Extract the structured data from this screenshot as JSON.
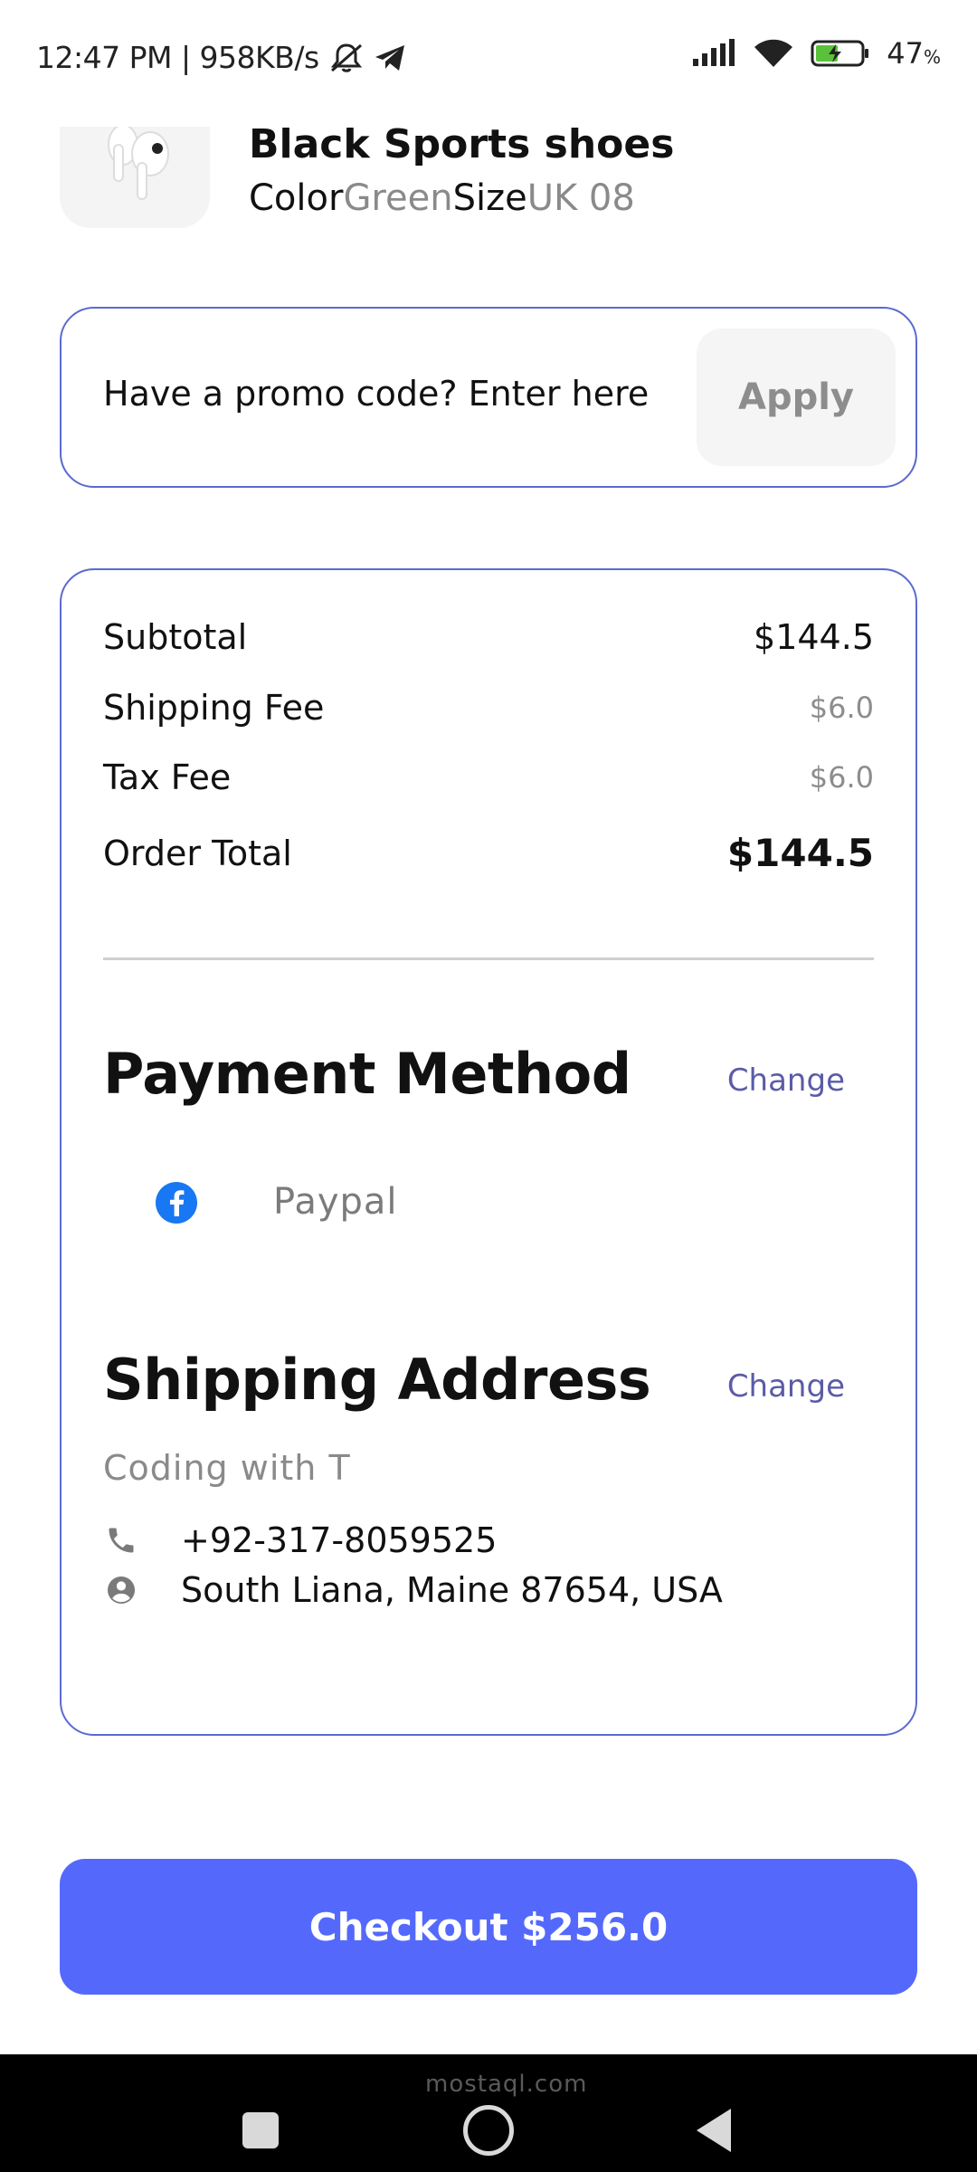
{
  "status_bar": {
    "time_network": "12:47 PM | 958KB/s",
    "battery_percent": "47",
    "battery_unit": "%"
  },
  "product": {
    "name": "Black Sports shoes",
    "color_label": "Color",
    "color_value": "Green",
    "size_label": "Size",
    "size_value": "UK 08"
  },
  "promo": {
    "prompt": "Have a promo code? Enter here",
    "apply_label": "Apply"
  },
  "summary": {
    "rows": [
      {
        "label": "Subtotal",
        "value": "$144.5"
      },
      {
        "label": "Shipping Fee",
        "value": "$6.0"
      },
      {
        "label": "Tax Fee",
        "value": "$6.0"
      },
      {
        "label": "Order Total",
        "value": "$144.5"
      }
    ]
  },
  "payment": {
    "title": "Payment Method",
    "change_label": "Change",
    "method": "Paypal",
    "icon": "facebook-icon"
  },
  "shipping": {
    "title": "Shipping Address",
    "change_label": "Change",
    "name": "Coding with T",
    "phone": "+92-317-8059525",
    "address": "South Liana, Maine 87654, USA"
  },
  "checkout": {
    "label": "Checkout $256.0"
  },
  "nav": {
    "watermark": "mostaql.com"
  },
  "colors": {
    "accent": "#5469fb",
    "card_border": "#5b6ad0",
    "link": "#5b5ba8",
    "muted": "#8d8d8d"
  }
}
